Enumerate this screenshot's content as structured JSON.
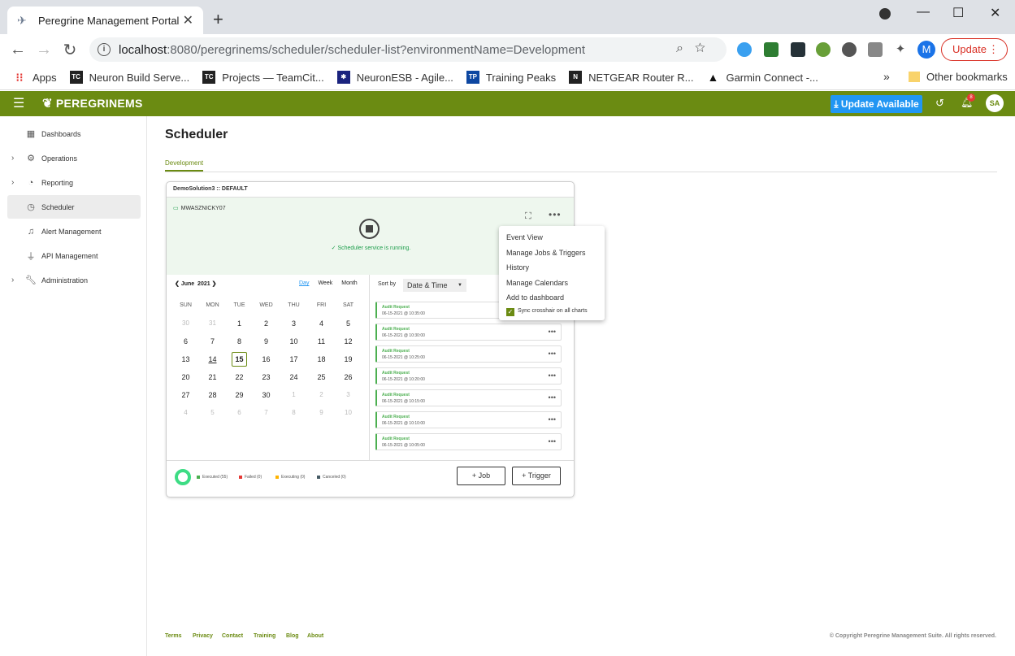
{
  "browser": {
    "tab_title": "Peregrine Management Portal",
    "new_tab": "+",
    "url_host": "localhost",
    "url_rest": ":8080/peregrinems/scheduler/scheduler-list?environmentName=Development",
    "update_label": "Update",
    "profile_initial": "M",
    "bookmarks": [
      {
        "label": "Apps"
      },
      {
        "label": "Neuron Build Serve..."
      },
      {
        "label": "Projects — TeamCit..."
      },
      {
        "label": "NeuronESB - Agile..."
      },
      {
        "label": "Training Peaks"
      },
      {
        "label": "NETGEAR Router R..."
      },
      {
        "label": "Garmin Connect -..."
      }
    ],
    "other_bookmarks": "Other bookmarks"
  },
  "app": {
    "brand": "PEREGRINEMS",
    "update_available": "Update Available",
    "notif_count": "8",
    "user_initials": "SA"
  },
  "sidebar": {
    "items": [
      {
        "label": "Dashboards",
        "icon": "dashboards-icon"
      },
      {
        "label": "Operations",
        "icon": "gear-icon"
      },
      {
        "label": "Reporting",
        "icon": "pie-chart-icon"
      },
      {
        "label": "Scheduler",
        "icon": "clock-icon"
      },
      {
        "label": "Alert Management",
        "icon": "bell-icon"
      },
      {
        "label": "API Management",
        "icon": "plug-icon"
      },
      {
        "label": "Administration",
        "icon": "wrench-icon"
      }
    ]
  },
  "page": {
    "title": "Scheduler",
    "env_tab": "Development"
  },
  "card": {
    "header": "DemoSolution3 :: DEFAULT",
    "host": "MWASZNICKY07",
    "status": "Scheduler service is running.",
    "calendar": {
      "month": "June",
      "year": "2021",
      "modes": [
        "Day",
        "Week",
        "Month"
      ],
      "dow": [
        "SUN",
        "MON",
        "TUE",
        "WED",
        "THU",
        "FRI",
        "SAT"
      ],
      "weeks": [
        [
          "30",
          "31",
          "1",
          "2",
          "3",
          "4",
          "5"
        ],
        [
          "6",
          "7",
          "8",
          "9",
          "10",
          "11",
          "12"
        ],
        [
          "13",
          "14",
          "15",
          "16",
          "17",
          "18",
          "19"
        ],
        [
          "20",
          "21",
          "22",
          "23",
          "24",
          "25",
          "26"
        ],
        [
          "27",
          "28",
          "29",
          "30",
          "1",
          "2",
          "3"
        ],
        [
          "4",
          "5",
          "6",
          "7",
          "8",
          "9",
          "10"
        ]
      ]
    },
    "sort_label": "Sort by",
    "sort_value": "Date & Time",
    "events": [
      {
        "title": "Audit Request",
        "time": "06-15-2021 @ 10:35:00"
      },
      {
        "title": "Audit Request",
        "time": "06-15-2021 @ 10:30:00"
      },
      {
        "title": "Audit Request",
        "time": "06-15-2021 @ 10:25:00"
      },
      {
        "title": "Audit Request",
        "time": "06-15-2021 @ 10:20:00"
      },
      {
        "title": "Audit Request",
        "time": "06-15-2021 @ 10:15:00"
      },
      {
        "title": "Audit Request",
        "time": "06-15-2021 @ 10:10:00"
      },
      {
        "title": "Audit Request",
        "time": "06-15-2021 @ 10:05:00"
      }
    ],
    "legend": [
      {
        "label": "Executed (55)",
        "color": "#4caf50"
      },
      {
        "label": "Failed (0)",
        "color": "#e53935"
      },
      {
        "label": "Executing (0)",
        "color": "#ffb300"
      },
      {
        "label": "Canceled (0)",
        "color": "#455a64"
      }
    ],
    "job_btn": "+ Job",
    "trigger_btn": "+ Trigger"
  },
  "menu": {
    "items": [
      "Event View",
      "Manage Jobs & Triggers",
      "History",
      "Manage Calendars",
      "Add to dashboard"
    ],
    "sync_label": "Sync crosshair on all charts"
  },
  "footer": {
    "links": [
      "Terms",
      "Privacy",
      "Contact",
      "Training",
      "Blog",
      "About"
    ],
    "copyright": "© Copyright Peregrine Management Suite. All rights reserved."
  }
}
